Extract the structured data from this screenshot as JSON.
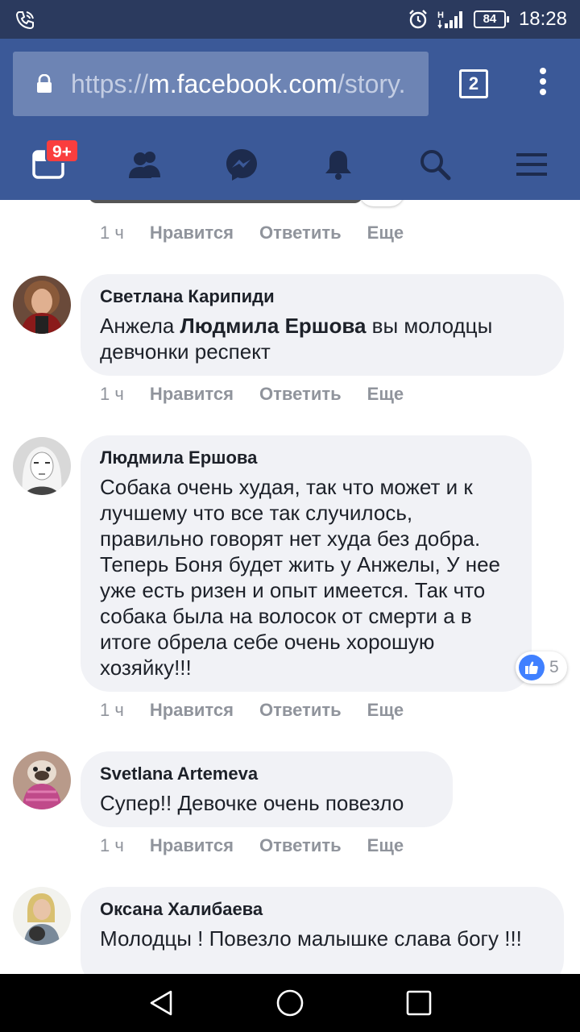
{
  "status_bar": {
    "battery": "84",
    "time": "18:28",
    "network": "H"
  },
  "browser": {
    "url_scheme": "https://",
    "url_host": "m.facebook.com",
    "url_path": "/story.",
    "tab_count": "2"
  },
  "fb_nav": {
    "notifications_badge": "9+",
    "items": [
      "feed-icon",
      "friends-icon",
      "messenger-icon",
      "bell-icon",
      "search-icon",
      "menu-icon"
    ]
  },
  "top_comment_meta": {
    "time": "1 ч",
    "like": "Нравится",
    "reply": "Ответить",
    "more": "Еще"
  },
  "comments": [
    {
      "author": "Светлана Карипиди",
      "text_before": "Анжела ",
      "text_bold": "Людмила Ершова",
      "text_after": " вы молодцы девчонки респект",
      "time": "1 ч",
      "like": "Нравится",
      "reply": "Ответить",
      "more": "Еще"
    },
    {
      "author": "Людмила Ершова",
      "text": "Собака очень худая, так что может и к лучшему что все так случилось, правильно говорят нет худа без добра. Теперь Боня будет жить у Анжелы, У нее уже есть ризен и опыт имеется. Так что собака была на волосок от смерти а в итоге обрела себе очень хорошую хозяйку!!!",
      "reaction_count": "5",
      "time": "1 ч",
      "like": "Нравится",
      "reply": "Ответить",
      "more": "Еще"
    },
    {
      "author": "Svetlana Artemeva",
      "text": "Супер!! Девочке очень повезло",
      "time": "1 ч",
      "like": "Нравится",
      "reply": "Ответить",
      "more": "Еще"
    },
    {
      "author": "Оксана Халибаева",
      "text": "Молодцы ! Повезло малышке слава богу !!!"
    }
  ],
  "colors": {
    "fb_blue": "#3b5998",
    "status_bar": "#2b3a5e",
    "bubble": "#f1f2f6",
    "meta_gray": "#90949c",
    "badge_red": "#fa3e3e",
    "like_blue": "#4080ff"
  }
}
